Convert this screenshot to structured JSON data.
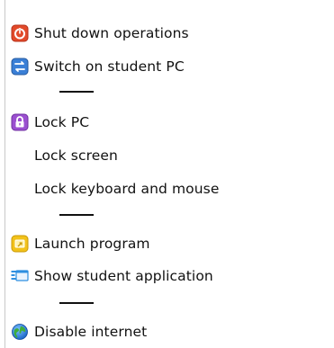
{
  "menu": {
    "items": [
      {
        "label": "Shut down operations",
        "icon": "power-icon"
      },
      {
        "label": "Switch on student PC",
        "icon": "switch-on-pc-icon"
      },
      {
        "label": "Lock PC",
        "icon": "lock-icon"
      },
      {
        "label": "Lock screen",
        "icon": ""
      },
      {
        "label": "Lock keyboard and mouse",
        "icon": ""
      },
      {
        "label": "Launch program",
        "icon": "launch-program-icon"
      },
      {
        "label": "Show student application",
        "icon": "show-application-icon"
      },
      {
        "label": "Disable internet",
        "icon": "globe-icon"
      }
    ]
  }
}
